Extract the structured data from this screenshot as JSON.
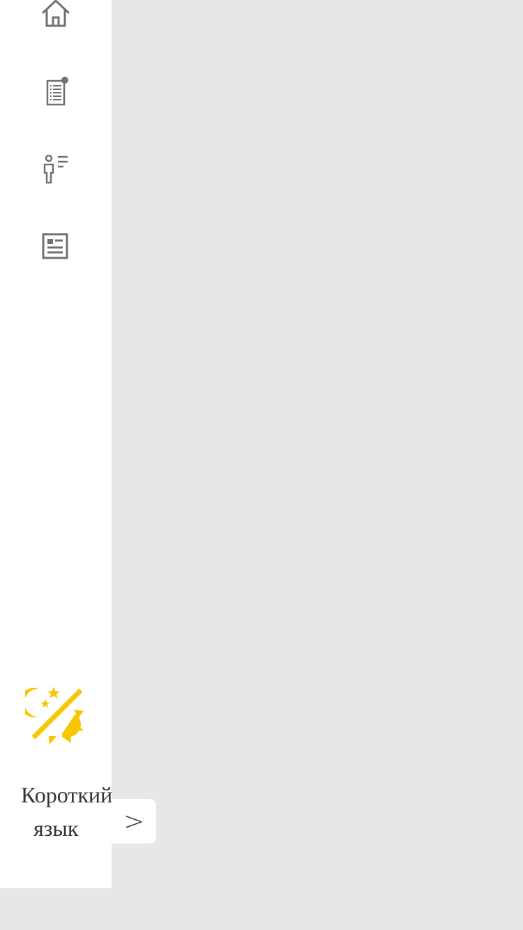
{
  "sidebar": {
    "items": [
      {
        "id": "home",
        "icon": "home-icon"
      },
      {
        "id": "notices",
        "icon": "document-list-icon",
        "badge": "dot"
      },
      {
        "id": "profile",
        "icon": "person-list-icon"
      },
      {
        "id": "news",
        "icon": "newspaper-icon"
      }
    ],
    "theme_toggle_icon": "day-night-toggle-icon",
    "language_line1": "Короткий",
    "language_line2": "язык",
    "expand_label": ">"
  },
  "colors": {
    "icon_gray": "#707070",
    "theme_yellow": "#f7c600",
    "sidebar_bg": "#ffffff",
    "content_bg": "#e7e7ea"
  }
}
